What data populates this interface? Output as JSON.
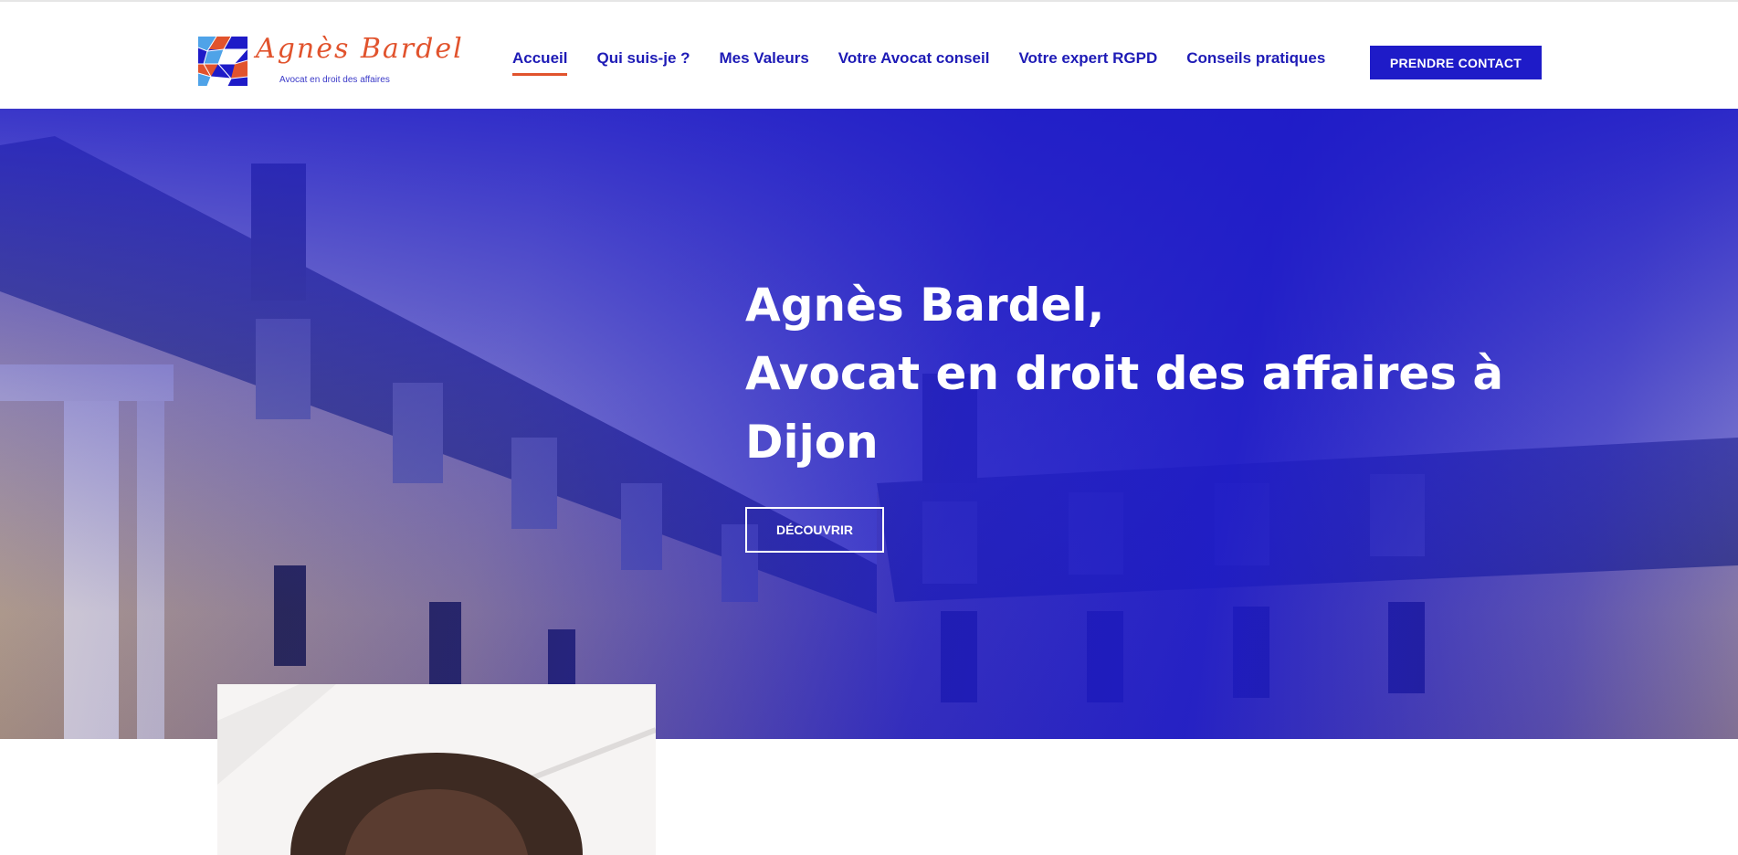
{
  "brand": {
    "name": "Agnès Bardel",
    "tagline": "Avocat en droit des affaires",
    "colors": {
      "primary": "#1e1bc8",
      "accent": "#e1532d",
      "nav_text": "#1e1bb6"
    }
  },
  "nav": {
    "items": [
      {
        "label": "Accueil",
        "active": true
      },
      {
        "label": "Qui suis-je ?"
      },
      {
        "label": "Mes Valeurs"
      },
      {
        "label": "Votre Avocat conseil"
      },
      {
        "label": "Votre expert RGPD"
      },
      {
        "label": "Conseils pratiques"
      }
    ],
    "cta_label": "PRENDRE CONTACT"
  },
  "hero": {
    "title_lines": [
      "Agnès Bardel,",
      "Avocat en droit des affaires à",
      "Dijon"
    ],
    "button_label": "DÉCOUVRIR"
  }
}
